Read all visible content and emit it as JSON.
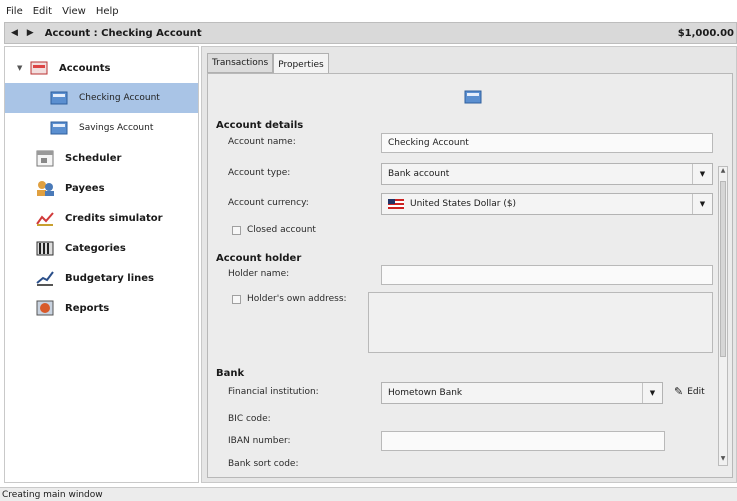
{
  "menu": [
    "File",
    "Edit",
    "View",
    "Help"
  ],
  "header": {
    "nav_arrows": "◀ ▶",
    "title": "Account : Checking Account",
    "balance": "$1,000.00"
  },
  "sidebar": {
    "items": [
      {
        "label": "Accounts"
      },
      {
        "label": "Checking Account"
      },
      {
        "label": "Savings Account"
      },
      {
        "label": "Scheduler"
      },
      {
        "label": "Payees"
      },
      {
        "label": "Credits simulator"
      },
      {
        "label": "Categories"
      },
      {
        "label": "Budgetary lines"
      },
      {
        "label": "Reports"
      }
    ]
  },
  "tabs": [
    "Transactions",
    "Properties"
  ],
  "form": {
    "account_details": "Account details",
    "account_name_label": "Account name:",
    "account_name_value": "Checking Account",
    "account_type_label": "Account type:",
    "account_type_value": "Bank account",
    "account_currency_label": "Account currency:",
    "account_currency_value": "United States Dollar ($)",
    "closed_account_label": "Closed account",
    "account_holder": "Account holder",
    "holder_name_label": "Holder name:",
    "holder_name_value": "",
    "holders_address_label": "Holder's own address:",
    "bank": "Bank",
    "financial_institution_label": "Financial institution:",
    "financial_institution_value": "Hometown Bank",
    "edit_label": "Edit",
    "bic_label": "BIC code:",
    "iban_label": "IBAN number:",
    "iban_value": "",
    "sort_code_label": "Bank sort code:"
  },
  "status": "Creating main window",
  "colors": {
    "selection": "#a9c4e6",
    "panel": "#ececec"
  }
}
